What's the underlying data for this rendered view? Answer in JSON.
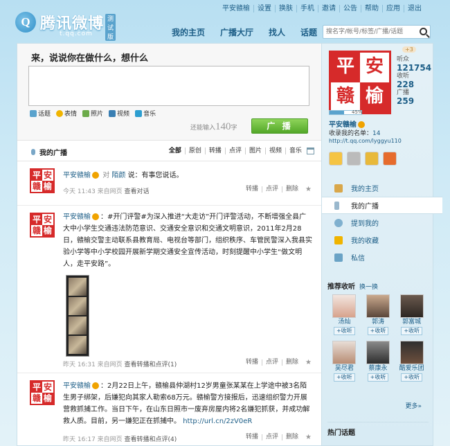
{
  "brand": {
    "logo_letter": "Q",
    "name": "腾讯微博",
    "beta": "测试版",
    "domain": "t.qq.com"
  },
  "toplinks": [
    "平安赣榆",
    "设置",
    "换肤",
    "手机",
    "邀请",
    "公告",
    "帮助",
    "应用",
    "退出"
  ],
  "mainnav": [
    "我的主页",
    "广播大厅",
    "找人",
    "话题"
  ],
  "search": {
    "placeholder": "搜名字/帐号/标签/广播/话题"
  },
  "composer": {
    "prompt": "来，说说你在做什么，想什么",
    "tools": [
      "话题",
      "表情",
      "照片",
      "视频",
      "音乐"
    ],
    "counter_prefix": "还能输入",
    "counter_value": "140",
    "counter_suffix": "字",
    "button": "广 播"
  },
  "feed_tabs": {
    "title": "我的广播",
    "filters": [
      "全部",
      "原创",
      "转播",
      "点评",
      "图片",
      "视频",
      "音乐"
    ]
  },
  "avatar": {
    "chars": [
      "平",
      "安",
      "赣",
      "榆"
    ]
  },
  "posts": [
    {
      "user": "平安赣榆",
      "text_pre": "对",
      "target": "陌颜",
      "text": "说：有事您说话。",
      "time": "今天 11:43 来自网页",
      "extra": "查看对话",
      "actions": [
        "转播",
        "点评",
        "删除"
      ]
    },
    {
      "user": "平安赣榆",
      "text": "：#开门评警#为深入推进“大走访”开门评警活动，不断增强全县广大中小学生交通违法防范意识、交通安全意识和交通文明意识，2011年2月28日，赣榆交警主动联系县教育局、电视台等部门，组织秩序、车管民警深入我县实验小学等中小学校园开展新学期交通安全宣传活动，时刻提醒中小学生“做文明人，走平安路”。",
      "time": "昨天 16:31 来自网页",
      "extra": "查看转播和点评(1)",
      "actions": [
        "转播",
        "点评",
        "删除"
      ]
    },
    {
      "user": "平安赣榆",
      "text": "：2月22日上午，赣榆县仲湖村12岁男童张某某在上学途中被3名陌生男子绑架，后嫌犯向其家人勒索68万元。赣榆警方接报后，迅速组织警力开展营救抓捕工作。当日下午，在山东日照市一废弃房屋内将2名嫌犯抓获，并成功解救人质。目前，另一嫌犯正在抓捕中。",
      "link": "http://url.cn/2zV0eR",
      "time": "昨天 16:17 来自网页",
      "extra": "查看转播和点评(4)",
      "actions": [
        "转播",
        "点评",
        "删除"
      ]
    }
  ],
  "profile": {
    "plus": "+3",
    "listeners_label": "听众",
    "listeners": "121754",
    "following_label": "收听",
    "following": "228",
    "broadcasts_label": "广播",
    "broadcasts": "259",
    "progress_pct": 45,
    "progress_label": "45%",
    "name": "平安赣榆",
    "list_prefix": "收录我的名单：",
    "list_count": "14",
    "url": "http://t.qq.com/lyggyu110"
  },
  "sidenav": [
    "我的主页",
    "我的广播",
    "提到我的",
    "我的收藏",
    "私信"
  ],
  "recommend": {
    "title": "推荐收听",
    "refresh": "换一换",
    "people": [
      "汤灿",
      "郭涛",
      "郭富城",
      "吴尽君",
      "蔡康永",
      "酷爱乐团"
    ],
    "follow_label": "+收听",
    "more": "更多»"
  },
  "hot_title": "热门话题",
  "colors": {
    "accent": "#1d5e87",
    "seal_red": "#d62a2a",
    "publish_green": "#52a728"
  }
}
